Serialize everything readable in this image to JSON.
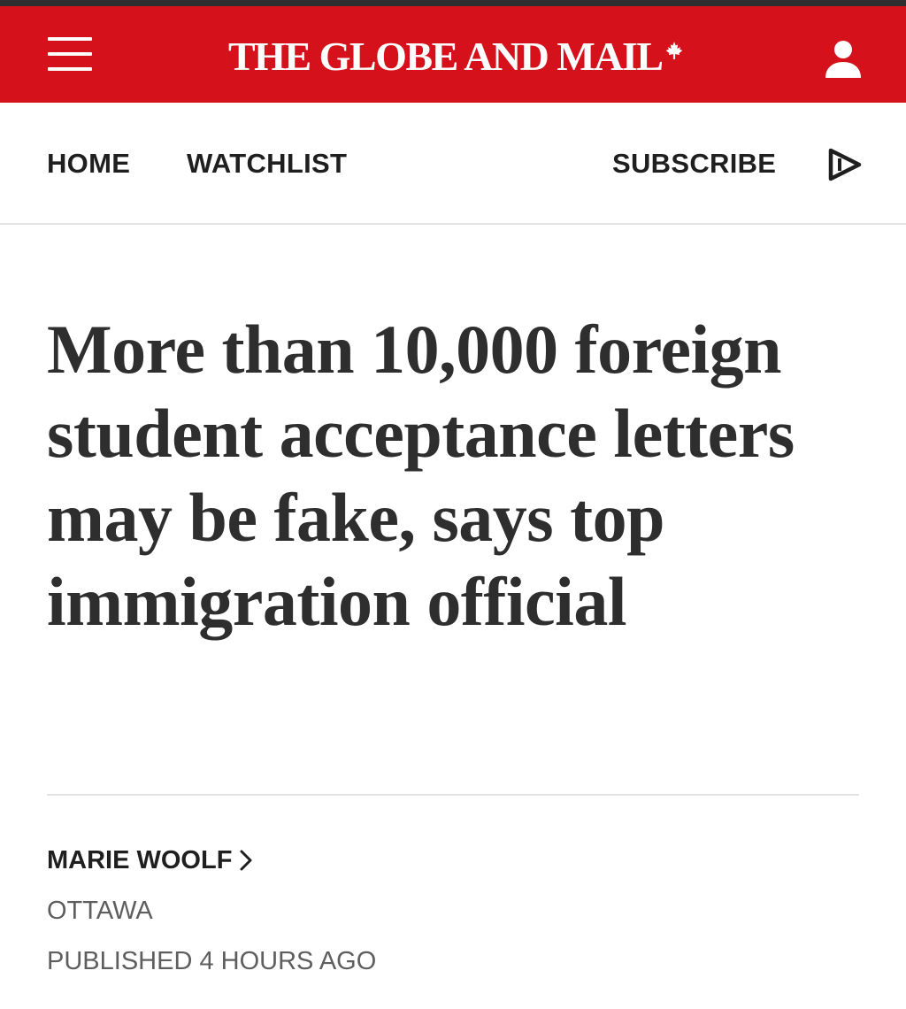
{
  "header": {
    "brand": "THE GLOBE AND MAIL",
    "brand_color": "#d5121b",
    "menu_icon": "hamburger-menu-icon",
    "logo_icon": "maple-leaf-icon",
    "account_icon": "user-account-icon"
  },
  "nav": {
    "items": [
      {
        "label": "HOME"
      },
      {
        "label": "WATCHLIST"
      }
    ],
    "subscribe_label": "SUBSCRIBE",
    "play_icon": "play-video-icon"
  },
  "article": {
    "headline": "More than 10,000 foreign student acceptance letters may be fake, says top immigration official",
    "author": "MARIE WOOLF",
    "author_link_icon": "chevron-right-icon",
    "dateline": "OTTAWA",
    "published": "PUBLISHED 4 HOURS AGO"
  }
}
